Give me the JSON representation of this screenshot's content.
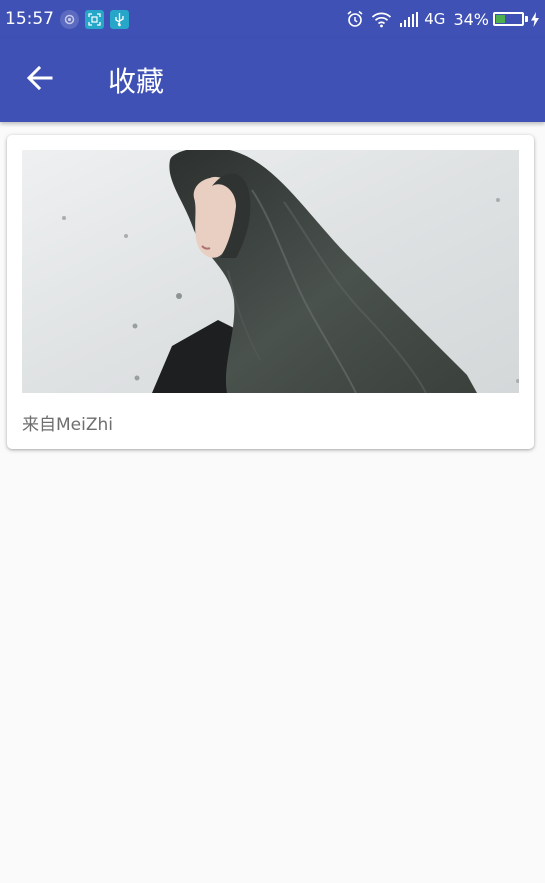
{
  "status_bar": {
    "time": "15:57",
    "network": "4G",
    "battery_percent": "34%",
    "battery_level": 0.34,
    "icons": [
      "app-notification-icon",
      "screenshot-notification-icon",
      "usb-notification-icon",
      "alarm-icon",
      "wifi-icon",
      "signal-icon",
      "battery-icon",
      "charging-icon"
    ]
  },
  "app_bar": {
    "title": "收藏",
    "back_icon": "arrow-left-icon"
  },
  "favorites": [
    {
      "image_description": "photo",
      "source_label": "来自MeiZhi"
    }
  ],
  "colors": {
    "primary": "#3f51b5",
    "background": "#fafafa",
    "card": "#ffffff",
    "caption": "#6e6e6e",
    "battery_fill": "#4caf50"
  }
}
